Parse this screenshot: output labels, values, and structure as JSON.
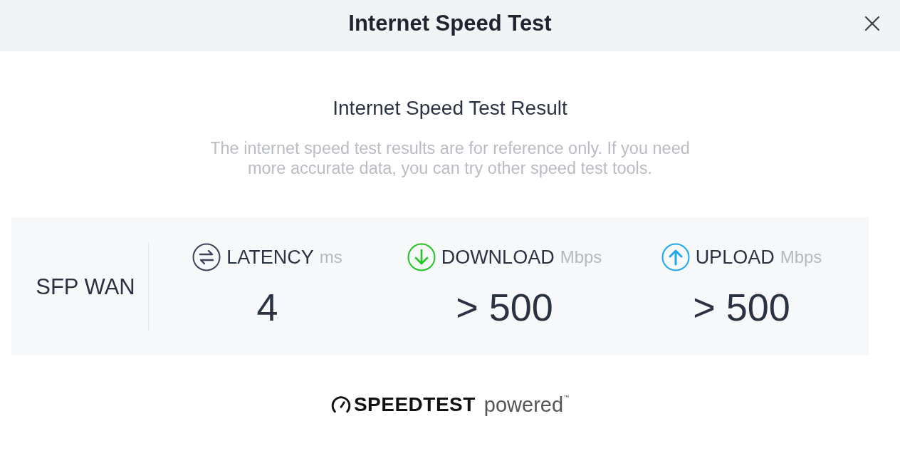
{
  "dialog": {
    "title": "Internet Speed Test"
  },
  "result": {
    "heading": "Internet Speed Test Result",
    "description": "The internet speed test results are for reference only. If you need more accurate data, you can try other speed test tools."
  },
  "panel": {
    "interface": "SFP WAN",
    "metrics": [
      {
        "kind": "latency",
        "label": "LATENCY",
        "unit": "ms",
        "value": "4",
        "color": "#3d4459"
      },
      {
        "kind": "download",
        "label": "DOWNLOAD",
        "unit": "Mbps",
        "value": "> 500",
        "color": "#22c322"
      },
      {
        "kind": "upload",
        "label": "UPLOAD",
        "unit": "Mbps",
        "value": "> 500",
        "color": "#1ea8f0"
      }
    ]
  },
  "footer": {
    "brand": "SPEEDTEST",
    "tagline": "powered$^{™}$"
  }
}
